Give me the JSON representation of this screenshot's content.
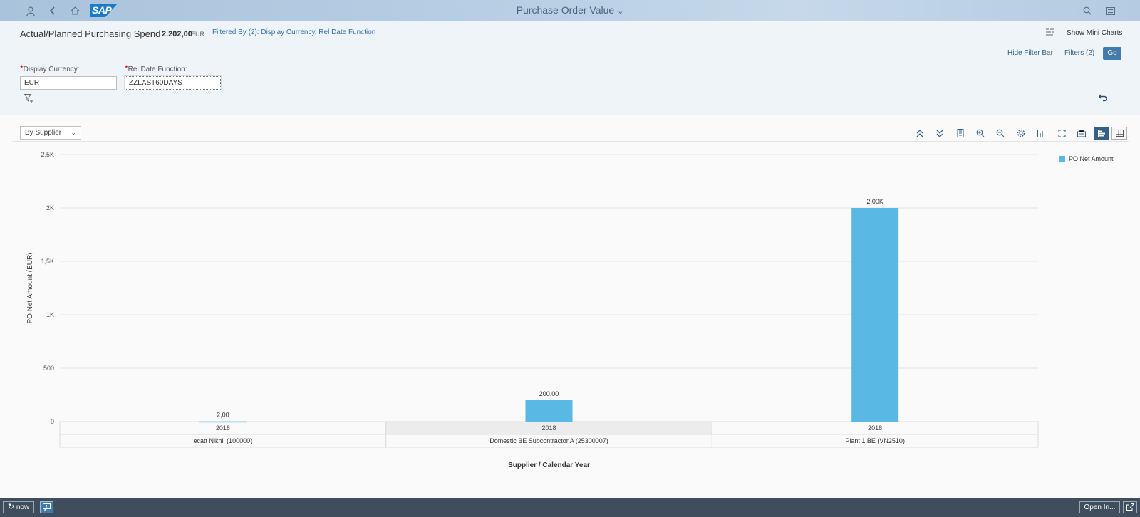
{
  "shell": {
    "title": "Purchase Order Value",
    "logo_text": "SAP",
    "icons": [
      "user-icon",
      "back-icon",
      "home-icon",
      "search-icon",
      "menu-icon"
    ]
  },
  "header": {
    "variant_title": "Actual/Planned Purchasing Spend",
    "total_amount": "2.202,00",
    "total_currency": "EUR",
    "filtered_by": "Filtered By (2): Display Currency, Rel Date Function",
    "show_mini_charts": "Show Mini Charts",
    "hide_filter_bar": "Hide Filter Bar",
    "filters_button": "Filters (2)",
    "go_button": "Go"
  },
  "filters": {
    "display_currency": {
      "label": "Display Currency:",
      "value": "EUR",
      "required_mark": "*"
    },
    "rel_date_function": {
      "label": "Rel Date Function:",
      "value": "ZZLAST60DAYS",
      "required_mark": "*"
    }
  },
  "toolbar": {
    "view_select": "By Supplier"
  },
  "footer": {
    "refresh_label": "now",
    "open_in_label": "Open In..."
  },
  "colors": {
    "bar": "#5ab8e4",
    "accent": "#427cac",
    "shell_footer": "#3f4d5d"
  },
  "chart_data": {
    "type": "bar",
    "ylabel": "PO Net Amount (EUR)",
    "xlabel": "Supplier / Calendar Year",
    "ylim": [
      0,
      2500
    ],
    "yticks": [
      0,
      500,
      1000,
      1500,
      2000,
      2500
    ],
    "ytick_labels": [
      "0",
      "500",
      "1K",
      "1,5K",
      "2K",
      "2,5K"
    ],
    "grid": true,
    "legend_position": "top-right",
    "categories": [
      {
        "supplier": "ecatt Nikhil (100000)",
        "year": "2018"
      },
      {
        "supplier": "Domestic BE Subcontractor A (25300007)",
        "year": "2018"
      },
      {
        "supplier": "Plant 1 BE (VN2510)",
        "year": "2018"
      }
    ],
    "series": [
      {
        "name": "PO Net Amount",
        "values": [
          2,
          200,
          2000
        ],
        "data_labels": [
          "2,00",
          "200,00",
          "2,00K"
        ]
      }
    ]
  }
}
